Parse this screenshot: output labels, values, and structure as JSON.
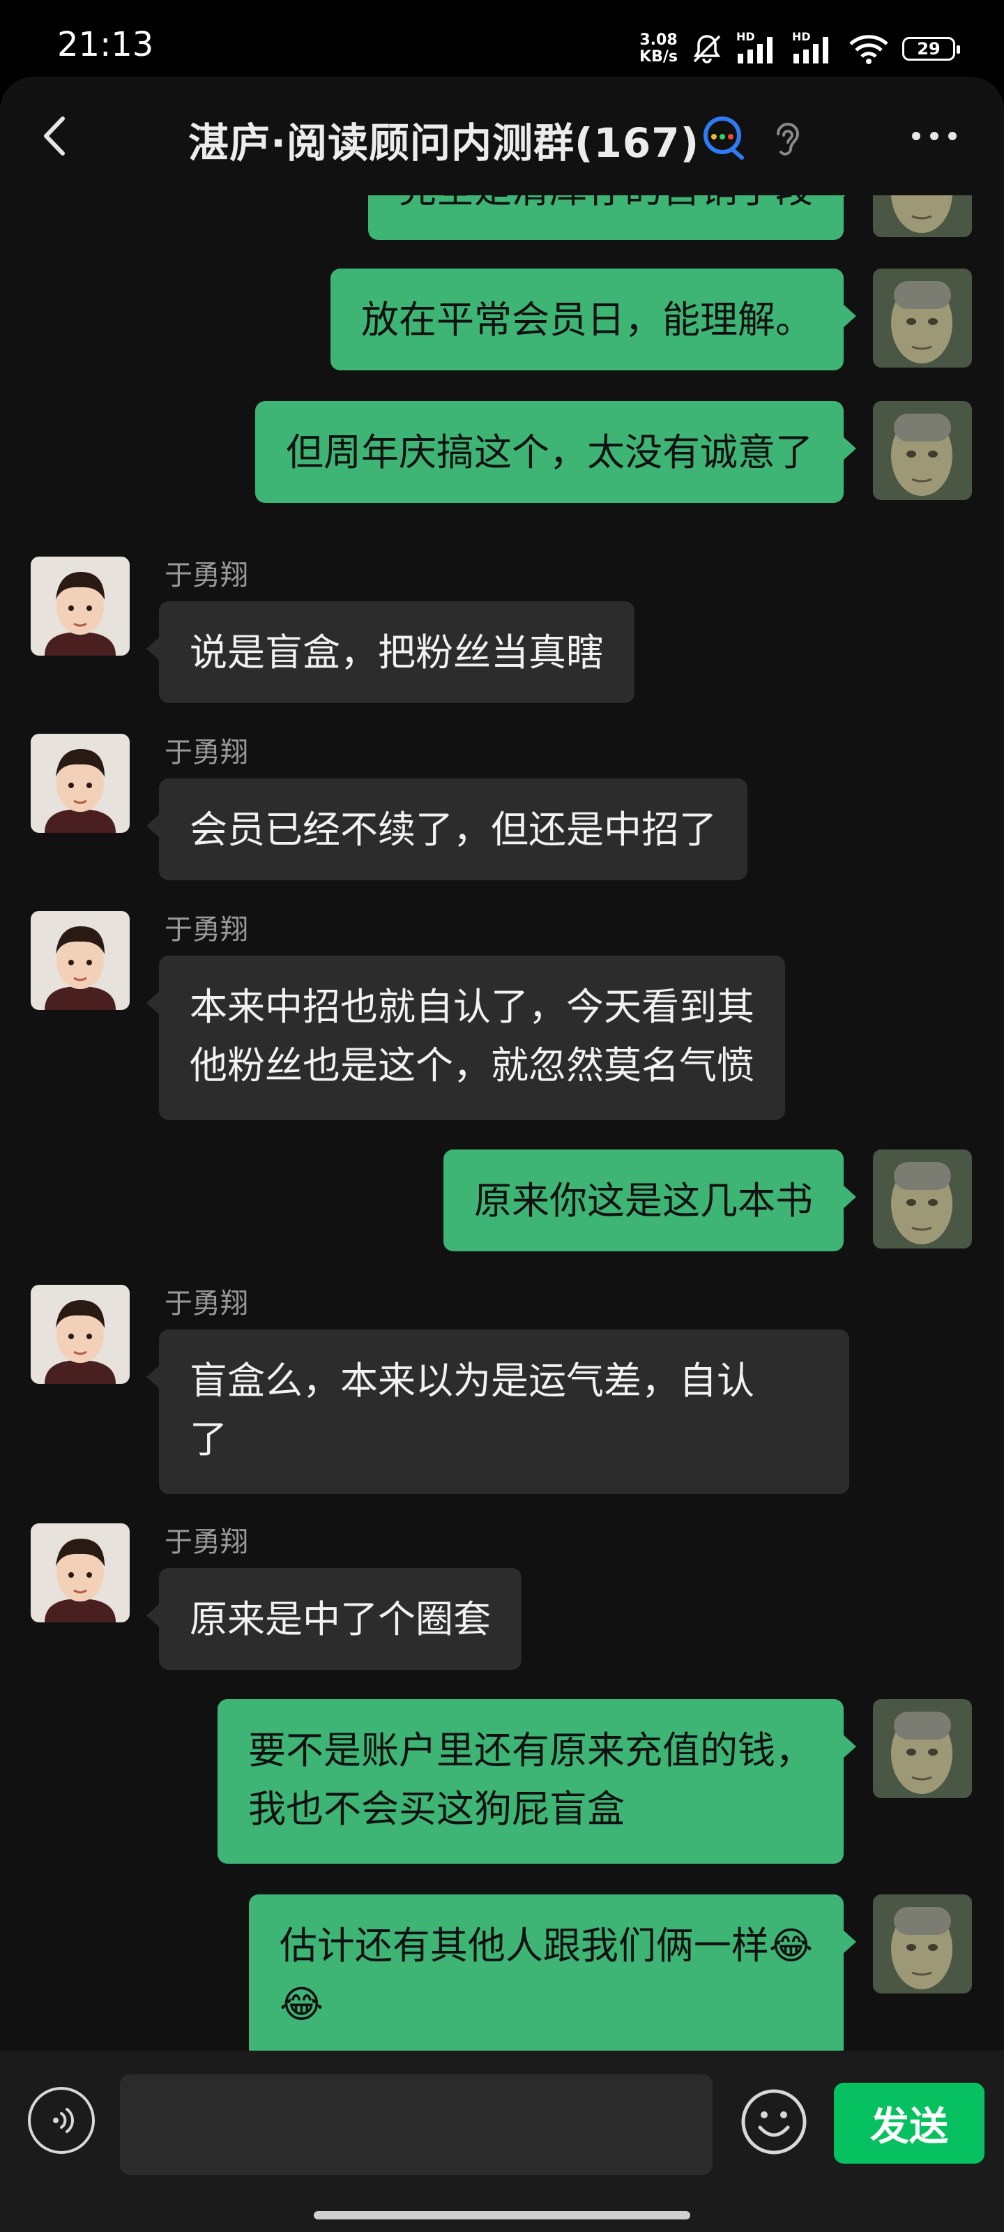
{
  "status_bar": {
    "time": "21:13",
    "speed_value": "3.08",
    "speed_unit": "KB/s",
    "hd1": "HD",
    "hd2": "HD",
    "battery": "29"
  },
  "header": {
    "title": "湛庐·阅读顾问内测群(167)"
  },
  "messages": [
    {
      "from": "me",
      "text": "完全是清库存的营销手段"
    },
    {
      "from": "me",
      "text": "放在平常会员日，能理解。"
    },
    {
      "from": "me",
      "text": "但周年庆搞这个，太没有诚意了"
    },
    {
      "from": "them",
      "sender": "于勇翔",
      "text": "说是盲盒，把粉丝当真瞎"
    },
    {
      "from": "them",
      "sender": "于勇翔",
      "text": "会员已经不续了，但还是中招了"
    },
    {
      "from": "them",
      "sender": "于勇翔",
      "line1": "本来中招也就自认了，今天看到其",
      "line2": "他粉丝也是这个，就忽然莫名气愤"
    },
    {
      "from": "me",
      "text": "原来你这是这几本书"
    },
    {
      "from": "them",
      "sender": "于勇翔",
      "line1": "盲盒么，本来以为是运气差，自认",
      "line2": "了"
    },
    {
      "from": "them",
      "sender": "于勇翔",
      "text": "原来是中了个圈套"
    },
    {
      "from": "me",
      "line1": "要不是账户里还有原来充值的钱，",
      "line2": "我也不会买这狗屁盲盒"
    },
    {
      "from": "me",
      "line1": "估计还有其他人跟我们俩一样😂",
      "line2": "😂"
    }
  ],
  "input_bar": {
    "placeholder": "",
    "send_label": "发送"
  },
  "colors": {
    "my_bubble": "#3eb575",
    "their_bubble": "#2c2c2c",
    "send_button": "#07c160",
    "background": "#111111"
  },
  "icons": {
    "back": "chevron-left-icon",
    "more": "more-horizontal-icon",
    "voice": "voice-icon",
    "emoji": "emoji-icon",
    "earpiece": "ear-icon",
    "group_chat": "chat-bubble-icon"
  }
}
